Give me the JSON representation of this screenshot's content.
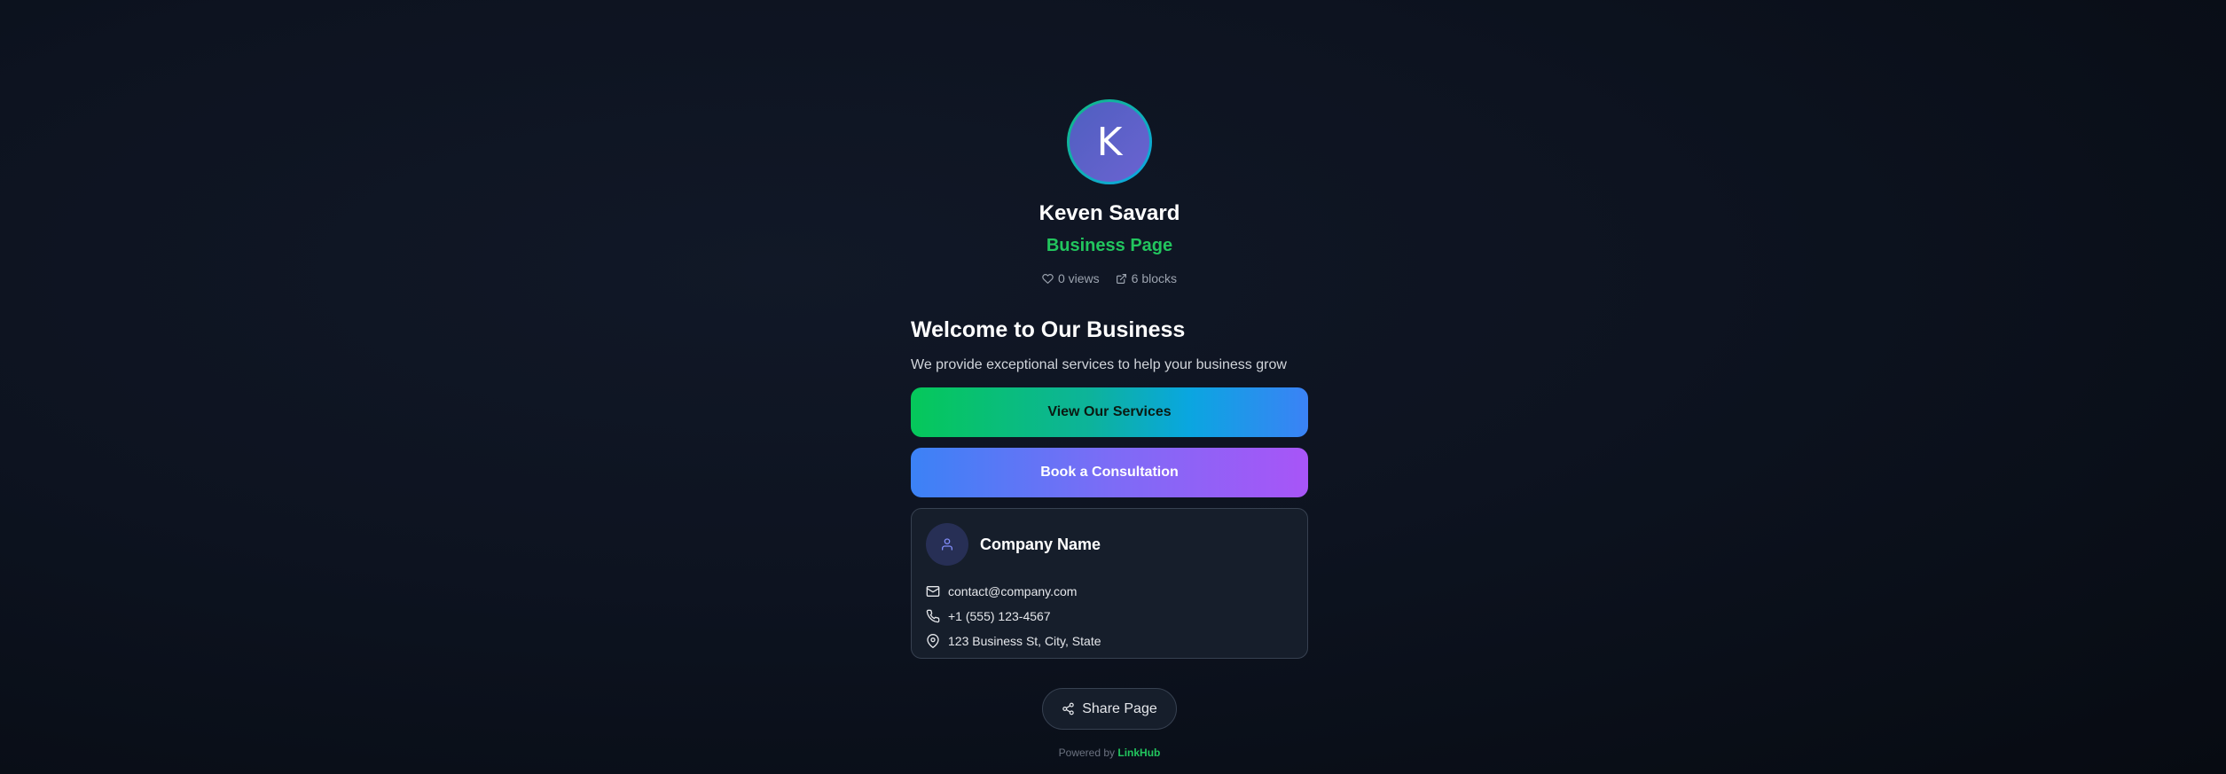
{
  "profile": {
    "avatar_initial": "K",
    "name": "Keven Savard",
    "subtitle": "Business Page",
    "views": "0 views",
    "blocks": "6 blocks"
  },
  "welcome": {
    "heading": "Welcome to Our Business",
    "text": "We provide exceptional services to help your business grow"
  },
  "buttons": {
    "services": "View Our Services",
    "consultation": "Book a Consultation"
  },
  "contact": {
    "company": "Company Name",
    "email": "contact@company.com",
    "phone": "+1 (555) 123-4567",
    "address": "123 Business St, City, State"
  },
  "share": {
    "label": "Share Page"
  },
  "footer": {
    "prefix": "Powered by",
    "brand": "LinkHub"
  },
  "icons": {
    "views": "heart-icon",
    "blocks": "external-link-icon",
    "contact_avatar": "user-icon",
    "email": "mail-icon",
    "phone": "phone-icon",
    "address": "map-pin-icon",
    "share": "share-icon"
  },
  "colors": {
    "accent_green": "#22c55e",
    "services_gradient": [
      "#05c85a",
      "#3b82f6"
    ],
    "consult_gradient": [
      "#3b82f6",
      "#a855f7"
    ],
    "avatar_fill": "#5b63c9",
    "background": "#0b1220"
  }
}
